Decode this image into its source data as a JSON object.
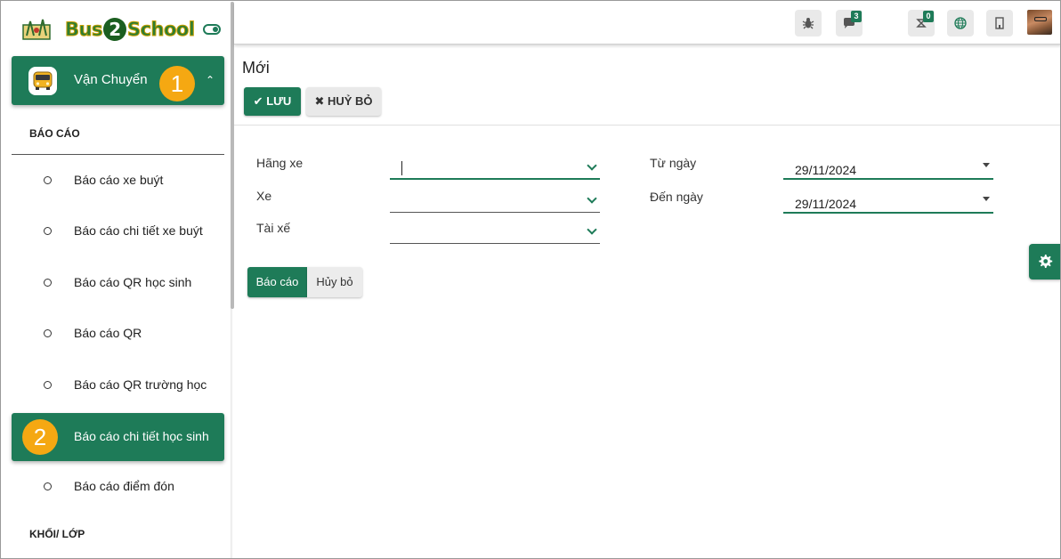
{
  "sidebar": {
    "brand": {
      "name": "Bus2School",
      "name_parts": [
        "Bus",
        "2",
        "School"
      ]
    },
    "module": {
      "label": "Vận Chuyển",
      "badge": "1",
      "icon": "bus-icon"
    },
    "section_reports": "BÁO CÁO",
    "items": [
      {
        "label": "Báo cáo xe buýt",
        "active": false
      },
      {
        "label": "Báo cáo chi tiết xe buýt",
        "active": false
      },
      {
        "label": "Báo cáo QR học sinh",
        "active": false
      },
      {
        "label": "Báo cáo QR",
        "active": false
      },
      {
        "label": "Báo cáo QR trường học",
        "active": false
      },
      {
        "label": "Báo cáo chi tiết học sinh",
        "active": true,
        "badge": "2"
      },
      {
        "label": "Báo cáo điểm đón",
        "active": false
      }
    ],
    "section_grades": "KHỐI/ LỚP"
  },
  "topbar": {
    "debug_icon": "bug-icon",
    "messages_count": "3",
    "activities_count": "0",
    "language_icon": "globe-icon",
    "company_icon": "building-icon",
    "avatar": "user-avatar"
  },
  "control_panel": {
    "title": "Mới",
    "save_label": "LƯU",
    "discard_label": "HUỶ BỎ"
  },
  "form": {
    "carrier_label": "Hãng xe",
    "carrier_value": "",
    "vehicle_label": "Xe",
    "vehicle_value": "",
    "driver_label": "Tài xế",
    "driver_value": "",
    "from_date_label": "Từ ngày",
    "from_date_value": "29/11/2024",
    "to_date_label": "Đến ngày",
    "to_date_value": "29/11/2024",
    "report_button": "Báo cáo",
    "cancel_button": "Hủy bỏ"
  },
  "colors": {
    "primary": "#1e7b58",
    "badge": "#f5a812",
    "button_secondary": "#e9e9e9"
  }
}
